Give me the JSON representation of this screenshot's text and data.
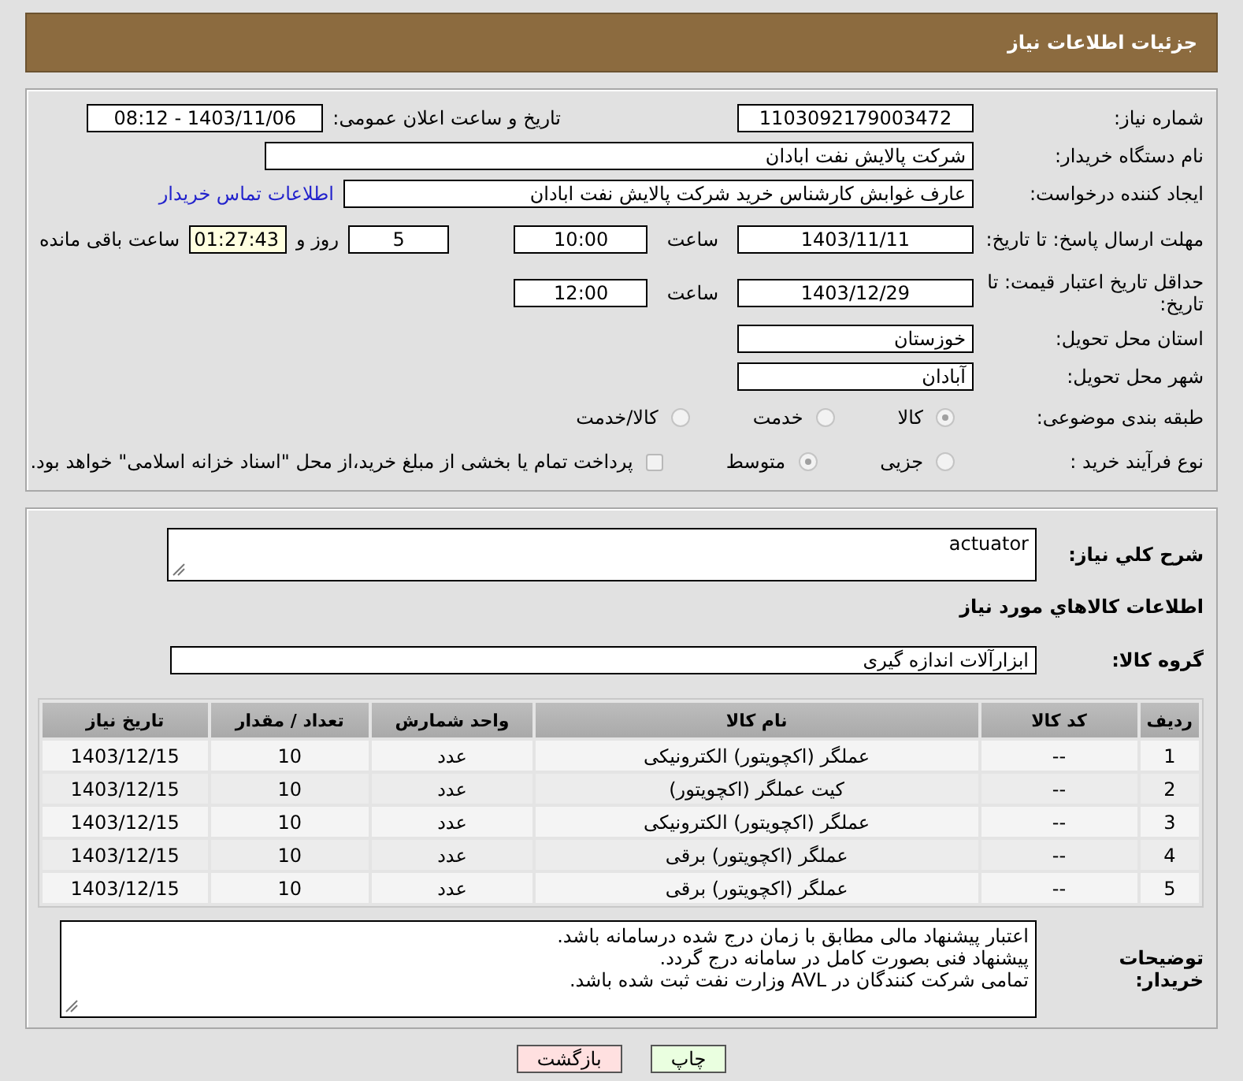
{
  "header": {
    "title": "جزئیات اطلاعات نیاز"
  },
  "need_number": {
    "label": "شماره نیاز:",
    "value": "1103092179003472"
  },
  "announce": {
    "label": "تاریخ و ساعت اعلان عمومی:",
    "value": "1403/11/06 - 08:12"
  },
  "buyer_org": {
    "label": "نام دستگاه خریدار:",
    "value": "شرکت پالایش نفت ابادان"
  },
  "requester": {
    "label": "ایجاد کننده درخواست:",
    "value": "عارف غوابش کارشناس خرید شرکت پالایش نفت ابادان",
    "link": "اطلاعات تماس خریدار"
  },
  "reply_deadline": {
    "label": "مهلت ارسال پاسخ: تا تاریخ:",
    "date": "1403/11/11",
    "time_label": "ساعت",
    "time": "10:00",
    "days": "5",
    "days_label": "روز و",
    "remaining": "01:27:43",
    "remaining_label": "ساعت باقی مانده"
  },
  "validity": {
    "label": "حداقل تاریخ اعتبار قیمت: تا تاریخ:",
    "date": "1403/12/29",
    "time_label": "ساعت",
    "time": "12:00"
  },
  "province": {
    "label": "استان محل تحویل:",
    "value": "خوزستان"
  },
  "city": {
    "label": "شهر محل تحویل:",
    "value": "آبادان"
  },
  "category": {
    "label": "طبقه بندی موضوعی:",
    "options": [
      {
        "label": "کالا",
        "selected": true
      },
      {
        "label": "خدمت",
        "selected": false
      },
      {
        "label": "کالا/خدمت",
        "selected": false
      }
    ]
  },
  "process": {
    "label": "نوع فرآیند خرید :",
    "options": [
      {
        "label": "جزیی",
        "selected": false
      },
      {
        "label": "متوسط",
        "selected": true
      }
    ],
    "treasury": {
      "label": "پرداخت تمام یا بخشی از مبلغ خرید،از محل \"اسناد خزانه اسلامی\" خواهد بود.",
      "checked": false
    }
  },
  "summary": {
    "label": "شرح کلي نياز:",
    "value": "actuator"
  },
  "goods_heading": "اطلاعات کالاهاي مورد نياز",
  "goods_group": {
    "label": "گروه کالا:",
    "value": "ابزارآلات اندازه گیری"
  },
  "table": {
    "columns": [
      "ردیف",
      "کد کالا",
      "نام کالا",
      "واحد شمارش",
      "تعداد / مقدار",
      "تاریخ نیاز"
    ],
    "rows": [
      [
        "1",
        "--",
        "عملگر (اکچویتور) الکترونیکی",
        "عدد",
        "10",
        "1403/12/15"
      ],
      [
        "2",
        "--",
        "کیت عملگر (اکچویتور)",
        "عدد",
        "10",
        "1403/12/15"
      ],
      [
        "3",
        "--",
        "عملگر (اکچویتور) الکترونیکی",
        "عدد",
        "10",
        "1403/12/15"
      ],
      [
        "4",
        "--",
        "عملگر (اکچویتور) برقی",
        "عدد",
        "10",
        "1403/12/15"
      ],
      [
        "5",
        "--",
        "عملگر (اکچویتور) برقی",
        "عدد",
        "10",
        "1403/12/15"
      ]
    ]
  },
  "buyer_notes": {
    "label": "توضیحات خریدار:",
    "lines": [
      "اعتبار پیشنهاد مالی مطابق با زمان درج شده درسامانه باشد.",
      "پیشنهاد فنی بصورت کامل در سامانه درج گردد.",
      "تمامی شرکت کنندگان در AVL وزارت نفت ثبت شده باشد."
    ]
  },
  "buttons": {
    "print": "چاپ",
    "back": "بازگشت"
  }
}
